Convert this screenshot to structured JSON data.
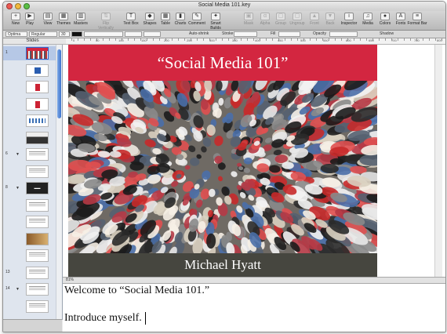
{
  "window": {
    "title": "Social Media 101.key"
  },
  "toolbar": {
    "items": [
      {
        "label": "New",
        "icon": "new-slide-icon",
        "glyph": "+"
      },
      {
        "label": "Play",
        "icon": "play-icon",
        "glyph": "▶"
      },
      {
        "label": "View",
        "icon": "view-icon",
        "glyph": "▤"
      },
      {
        "label": "Themes",
        "icon": "themes-icon",
        "glyph": "▦"
      },
      {
        "label": "Masters",
        "icon": "masters-icon",
        "glyph": "▥"
      },
      {
        "label": "Flip Vertically",
        "icon": "flip-vertically-icon",
        "glyph": "⇅",
        "dim": true
      },
      {
        "label": "Text Box",
        "icon": "text-box-icon",
        "glyph": "T"
      },
      {
        "label": "Shapes",
        "icon": "shapes-icon",
        "glyph": "◆"
      },
      {
        "label": "Table",
        "icon": "table-icon",
        "glyph": "▦"
      },
      {
        "label": "Charts",
        "icon": "charts-icon",
        "glyph": "▮"
      },
      {
        "label": "Comment",
        "icon": "comment-icon",
        "glyph": "✎"
      },
      {
        "label": "Smart Builds",
        "icon": "smart-builds-icon",
        "glyph": "✦"
      },
      {
        "label": "Mask",
        "icon": "mask-icon",
        "glyph": "▣",
        "dim": true
      },
      {
        "label": "Alpha",
        "icon": "alpha-icon",
        "glyph": "α",
        "dim": true
      },
      {
        "label": "Group",
        "icon": "group-icon",
        "glyph": "▢",
        "dim": true
      },
      {
        "label": "Ungroup",
        "icon": "ungroup-icon",
        "glyph": "▢",
        "dim": true
      },
      {
        "label": "Front",
        "icon": "front-icon",
        "glyph": "▲",
        "dim": true
      },
      {
        "label": "Back",
        "icon": "back-icon",
        "glyph": "▼",
        "dim": true
      },
      {
        "label": "Inspector",
        "icon": "inspector-icon",
        "glyph": "i"
      },
      {
        "label": "Media",
        "icon": "media-icon",
        "glyph": "♫"
      },
      {
        "label": "Colors",
        "icon": "colors-icon",
        "glyph": "●"
      },
      {
        "label": "Fonts",
        "icon": "fonts-icon",
        "glyph": "A"
      },
      {
        "label": "Format Bar",
        "icon": "format-bar-icon",
        "glyph": "≡"
      }
    ]
  },
  "formatbar": {
    "font_family": "Optima",
    "font_style": "Regular",
    "font_size": "30",
    "autoshrink": "Auto-shrink",
    "stroke": "Stroke",
    "fill": "Fill",
    "opacity": "Opacity",
    "shadow": "Shadow"
  },
  "sidebar": {
    "label": "Slides",
    "slides": [
      {
        "num": "1",
        "kind": "crowd",
        "selected": true
      },
      {
        "num": "",
        "kind": "logo"
      },
      {
        "num": "",
        "kind": "figure"
      },
      {
        "num": "",
        "kind": "figure"
      },
      {
        "num": "",
        "kind": "people"
      },
      {
        "num": "",
        "kind": "dark"
      },
      {
        "num": "6",
        "kind": "text",
        "collapse": true
      },
      {
        "num": "",
        "kind": "text"
      },
      {
        "num": "8",
        "kind": "black",
        "collapse": true
      },
      {
        "num": "",
        "kind": "text"
      },
      {
        "num": "",
        "kind": "text"
      },
      {
        "num": "",
        "kind": "photo"
      },
      {
        "num": "",
        "kind": "text"
      },
      {
        "num": "13",
        "kind": "text"
      },
      {
        "num": "14",
        "kind": "text",
        "collapse": true
      },
      {
        "num": "",
        "kind": "text"
      }
    ]
  },
  "ruler": {
    "ticks": [
      "0",
      "50",
      "100",
      "150",
      "200",
      "250",
      "300",
      "350",
      "400",
      "450",
      "500",
      "550",
      "600",
      "650",
      "700",
      "750",
      "800"
    ]
  },
  "slide": {
    "title": "“Social Media 101”",
    "subtitle": "Michael Hyatt",
    "title_band_color": "#d32640",
    "bottom_band_color": "#46463f"
  },
  "zoom": {
    "value": "81%"
  },
  "notes": {
    "line1": "Welcome to “Social Media 101.”",
    "line2": "Introduce myself."
  }
}
